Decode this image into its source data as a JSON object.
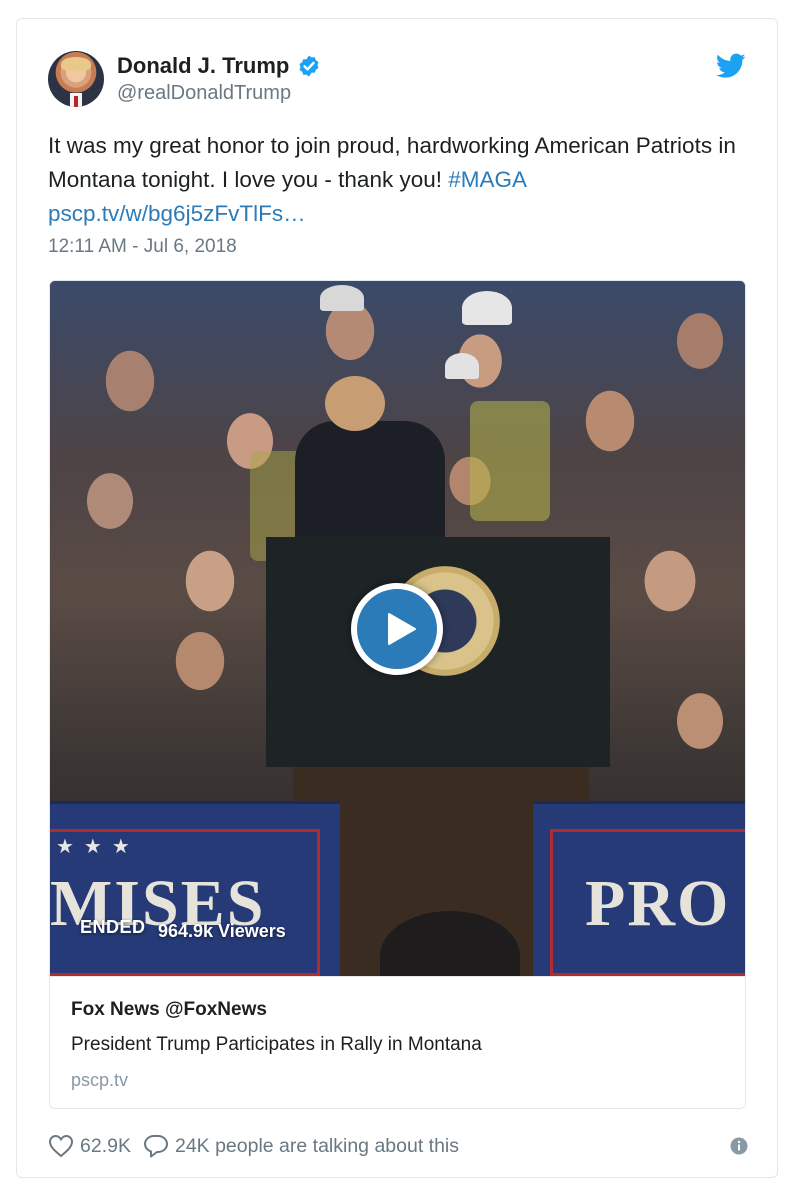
{
  "tweet": {
    "author_name": "Donald J. Trump",
    "author_handle": "@realDonaldTrump",
    "text_main": "It was my great honor to join proud, hardworking American Patriots in Montana tonight. I love you - thank you! ",
    "hashtag": "#MAGA",
    "link": "pscp.tv/w/bg6j5zFvTlFs…",
    "timestamp": "12:11 AM - Jul 6, 2018"
  },
  "media": {
    "status": "ENDED",
    "viewers": "964.9k Viewers",
    "sign_left_text": "MISES",
    "sign_right_text": "PRO",
    "card_author": "Fox News @FoxNews",
    "card_title": "President Trump Participates in Rally in Montana",
    "card_domain": "pscp.tv"
  },
  "footer": {
    "likes": "62.9K",
    "conversation": "24K people are talking about this"
  },
  "colors": {
    "link_blue": "#2b7bb9",
    "twitter_blue": "#1da1f2",
    "muted_gray": "#697882"
  },
  "icons": {
    "verified": "verified-badge-icon",
    "twitter": "twitter-bird-icon",
    "play": "play-icon",
    "like": "heart-icon",
    "reply": "speech-bubble-icon",
    "info": "info-icon"
  }
}
